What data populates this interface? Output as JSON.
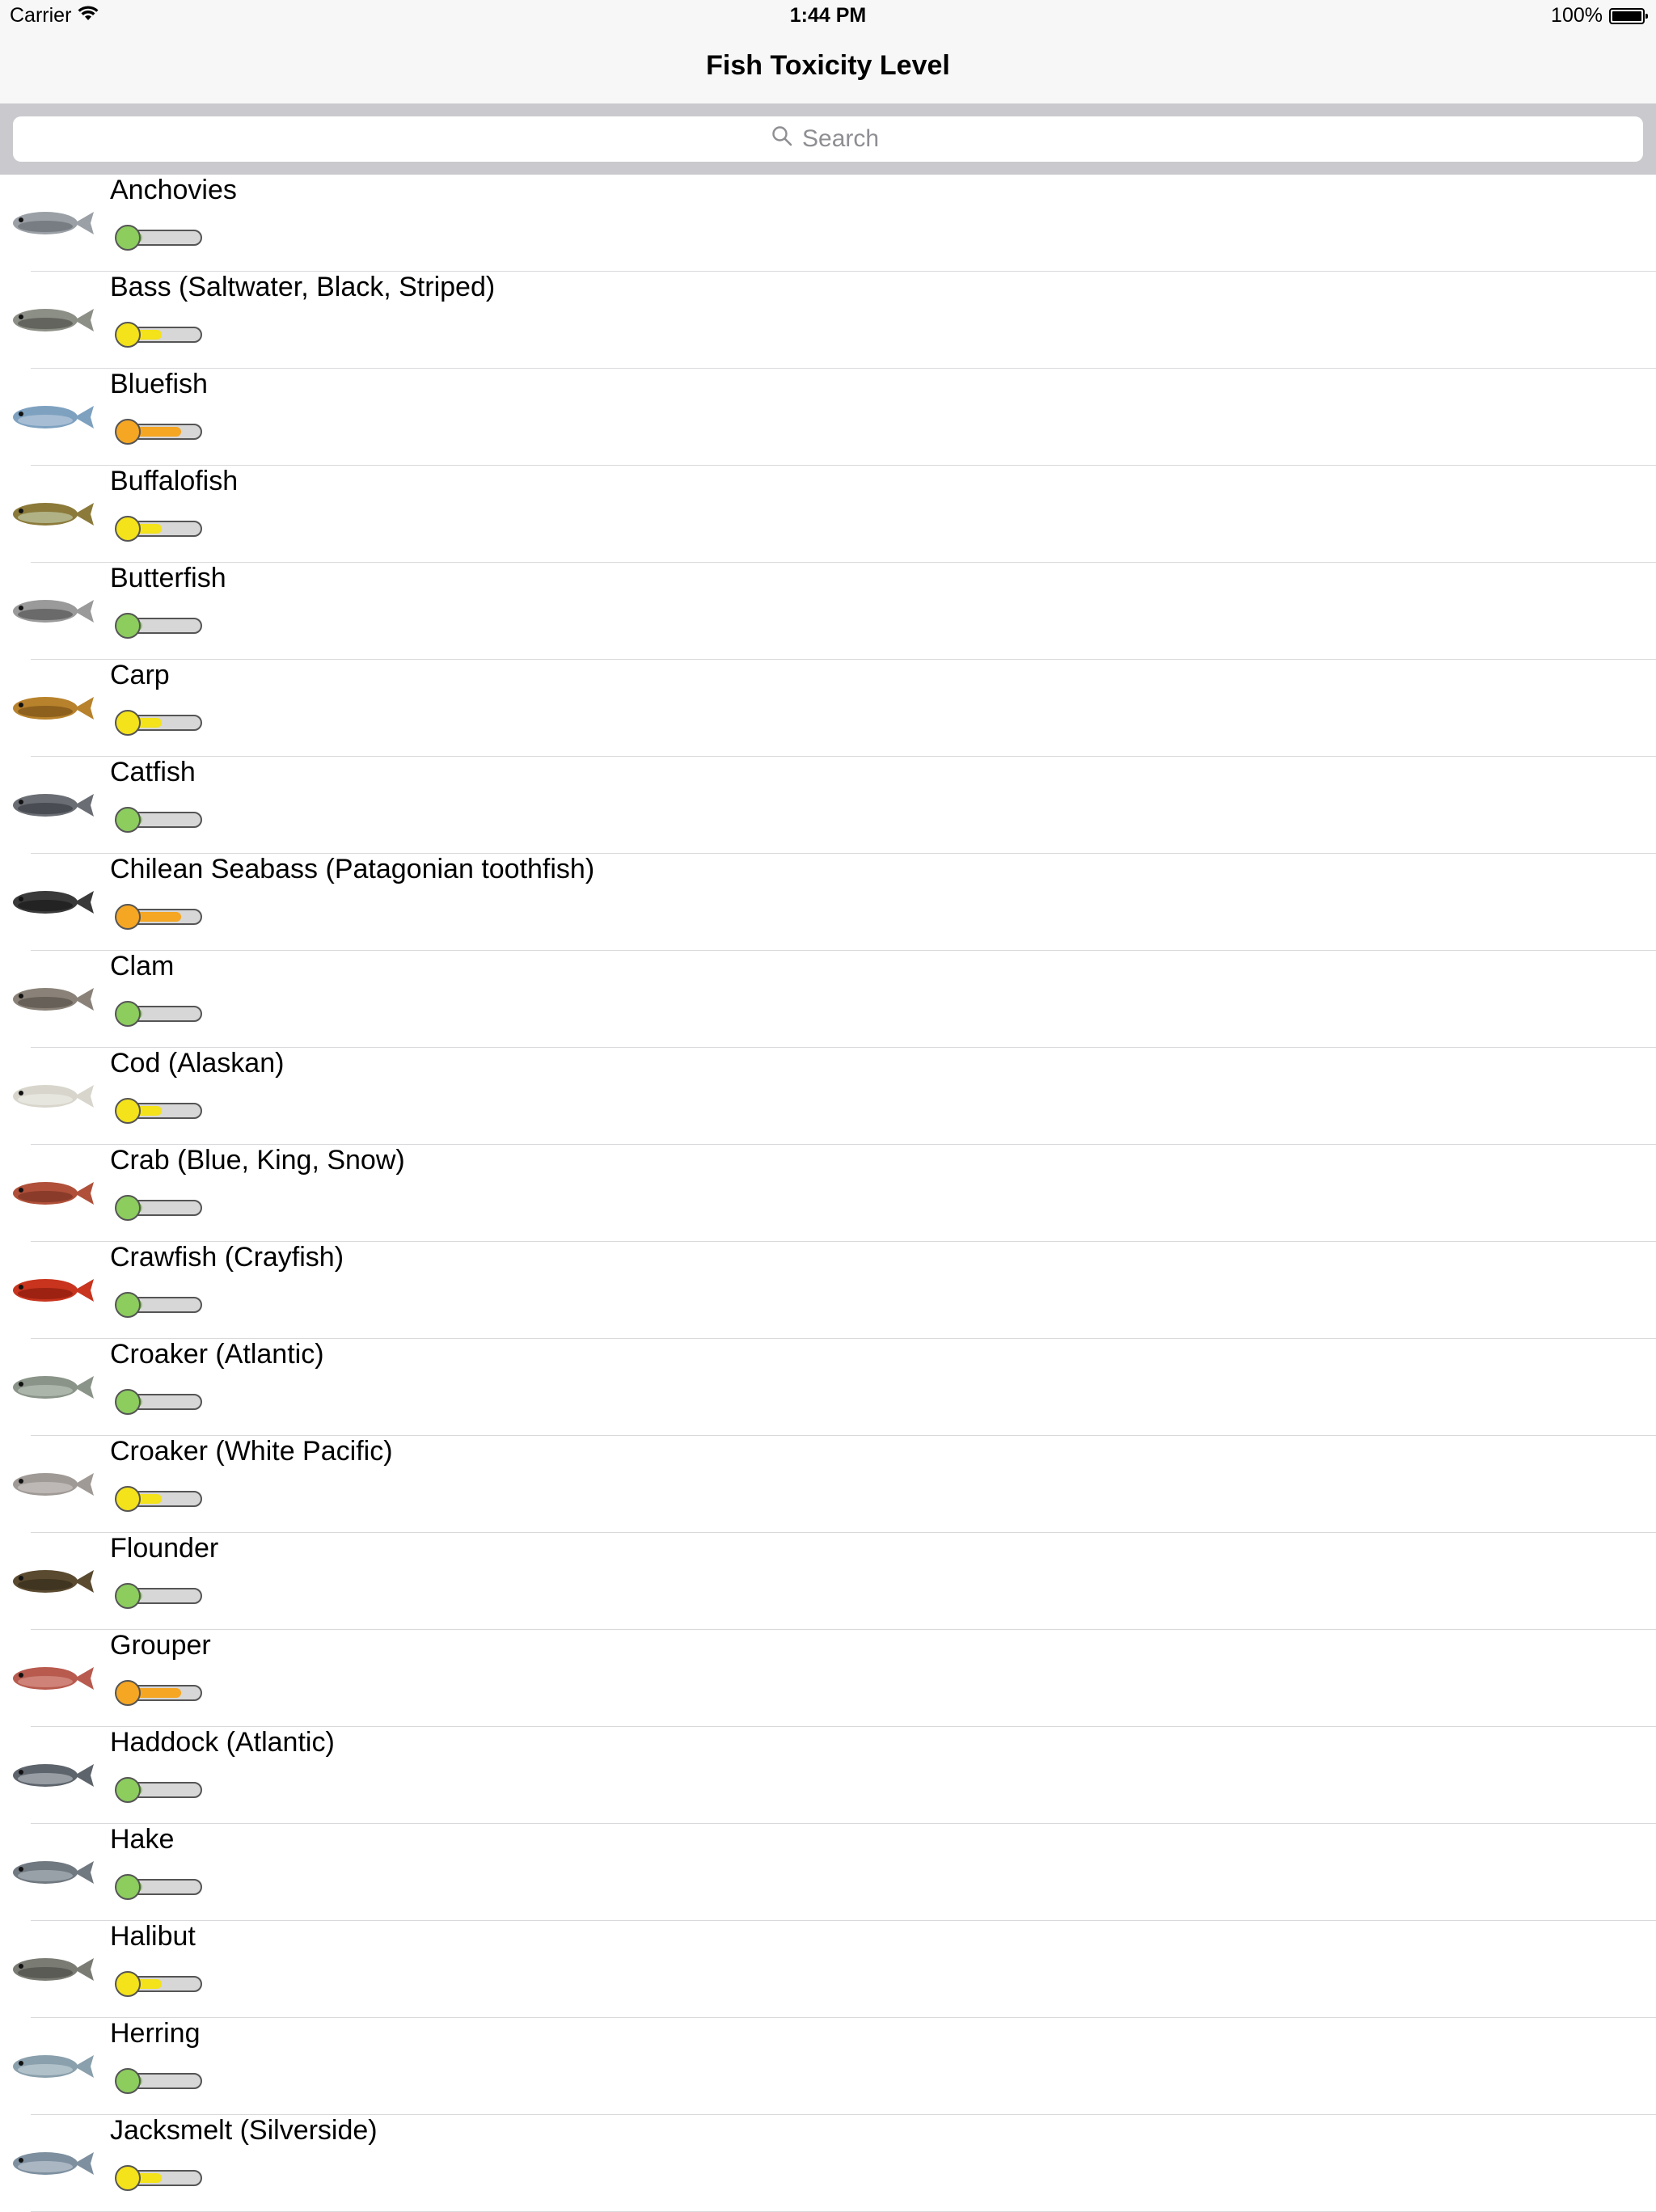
{
  "status_bar": {
    "carrier": "Carrier",
    "time": "1:44 PM",
    "battery": "100%",
    "wifi_icon": "wifi-icon",
    "battery_icon": "battery-icon"
  },
  "nav": {
    "title": "Fish Toxicity Level"
  },
  "search": {
    "placeholder": "Search",
    "icon": "search-icon"
  },
  "level_colors": {
    "low": "#8ccd5e",
    "medium": "#f4e21a",
    "high": "#f5a623"
  },
  "items": [
    {
      "name": "Anchovies",
      "level": "low",
      "fill": 0.25,
      "thumb": [
        "#9aa0a6",
        "#5c6166"
      ]
    },
    {
      "name": "Bass (Saltwater, Black, Striped)",
      "level": "medium",
      "fill": 0.5,
      "thumb": [
        "#8c8f86",
        "#3f423c"
      ]
    },
    {
      "name": "Bluefish",
      "level": "high",
      "fill": 0.75,
      "thumb": [
        "#7ea1c0",
        "#c9d6e2"
      ]
    },
    {
      "name": "Buffalofish",
      "level": "medium",
      "fill": 0.5,
      "thumb": [
        "#8b7a3a",
        "#cfe0c2"
      ]
    },
    {
      "name": "Butterfish",
      "level": "low",
      "fill": 0.25,
      "thumb": [
        "#9a9a9a",
        "#444444"
      ]
    },
    {
      "name": "Carp",
      "level": "medium",
      "fill": 0.5,
      "thumb": [
        "#b8822c",
        "#6a4512"
      ]
    },
    {
      "name": "Catfish",
      "level": "low",
      "fill": 0.25,
      "thumb": [
        "#6a6e74",
        "#2e3236"
      ]
    },
    {
      "name": "Chilean Seabass (Patagonian toothfish)",
      "level": "high",
      "fill": 0.75,
      "thumb": [
        "#3a3a3a",
        "#111111"
      ]
    },
    {
      "name": "Clam",
      "level": "low",
      "fill": 0.25,
      "thumb": [
        "#8a8278",
        "#4b453e"
      ]
    },
    {
      "name": "Cod (Alaskan)",
      "level": "medium",
      "fill": 0.5,
      "thumb": [
        "#d8d6cc",
        "#f2f2ec"
      ]
    },
    {
      "name": "Crab (Blue, King, Snow)",
      "level": "low",
      "fill": 0.25,
      "thumb": [
        "#b0503a",
        "#6e2a1c"
      ]
    },
    {
      "name": "Crawfish (Crayfish)",
      "level": "low",
      "fill": 0.25,
      "thumb": [
        "#c8341e",
        "#7a140a"
      ]
    },
    {
      "name": "Croaker (Atlantic)",
      "level": "low",
      "fill": 0.25,
      "thumb": [
        "#8a9488",
        "#c9d0c6"
      ]
    },
    {
      "name": "Croaker (White Pacific)",
      "level": "medium",
      "fill": 0.5,
      "thumb": [
        "#a09a96",
        "#d6d2cf"
      ]
    },
    {
      "name": "Flounder",
      "level": "low",
      "fill": 0.25,
      "thumb": [
        "#5a4a30",
        "#2c2416"
      ]
    },
    {
      "name": "Grouper",
      "level": "high",
      "fill": 0.75,
      "thumb": [
        "#b85a4e",
        "#e0a49a"
      ]
    },
    {
      "name": "Haddock (Atlantic)",
      "level": "low",
      "fill": 0.25,
      "thumb": [
        "#5e646c",
        "#c6ccd2"
      ]
    },
    {
      "name": "Hake",
      "level": "low",
      "fill": 0.25,
      "thumb": [
        "#707880",
        "#bcc2c8"
      ]
    },
    {
      "name": "Halibut",
      "level": "medium",
      "fill": 0.5,
      "thumb": [
        "#7a7c74",
        "#3e403a"
      ]
    },
    {
      "name": "Herring",
      "level": "low",
      "fill": 0.25,
      "thumb": [
        "#8aa0ac",
        "#d2dce2"
      ]
    },
    {
      "name": "Jacksmelt (Silverside)",
      "level": "medium",
      "fill": 0.5,
      "thumb": [
        "#7e90a0",
        "#cdd6de"
      ]
    }
  ]
}
